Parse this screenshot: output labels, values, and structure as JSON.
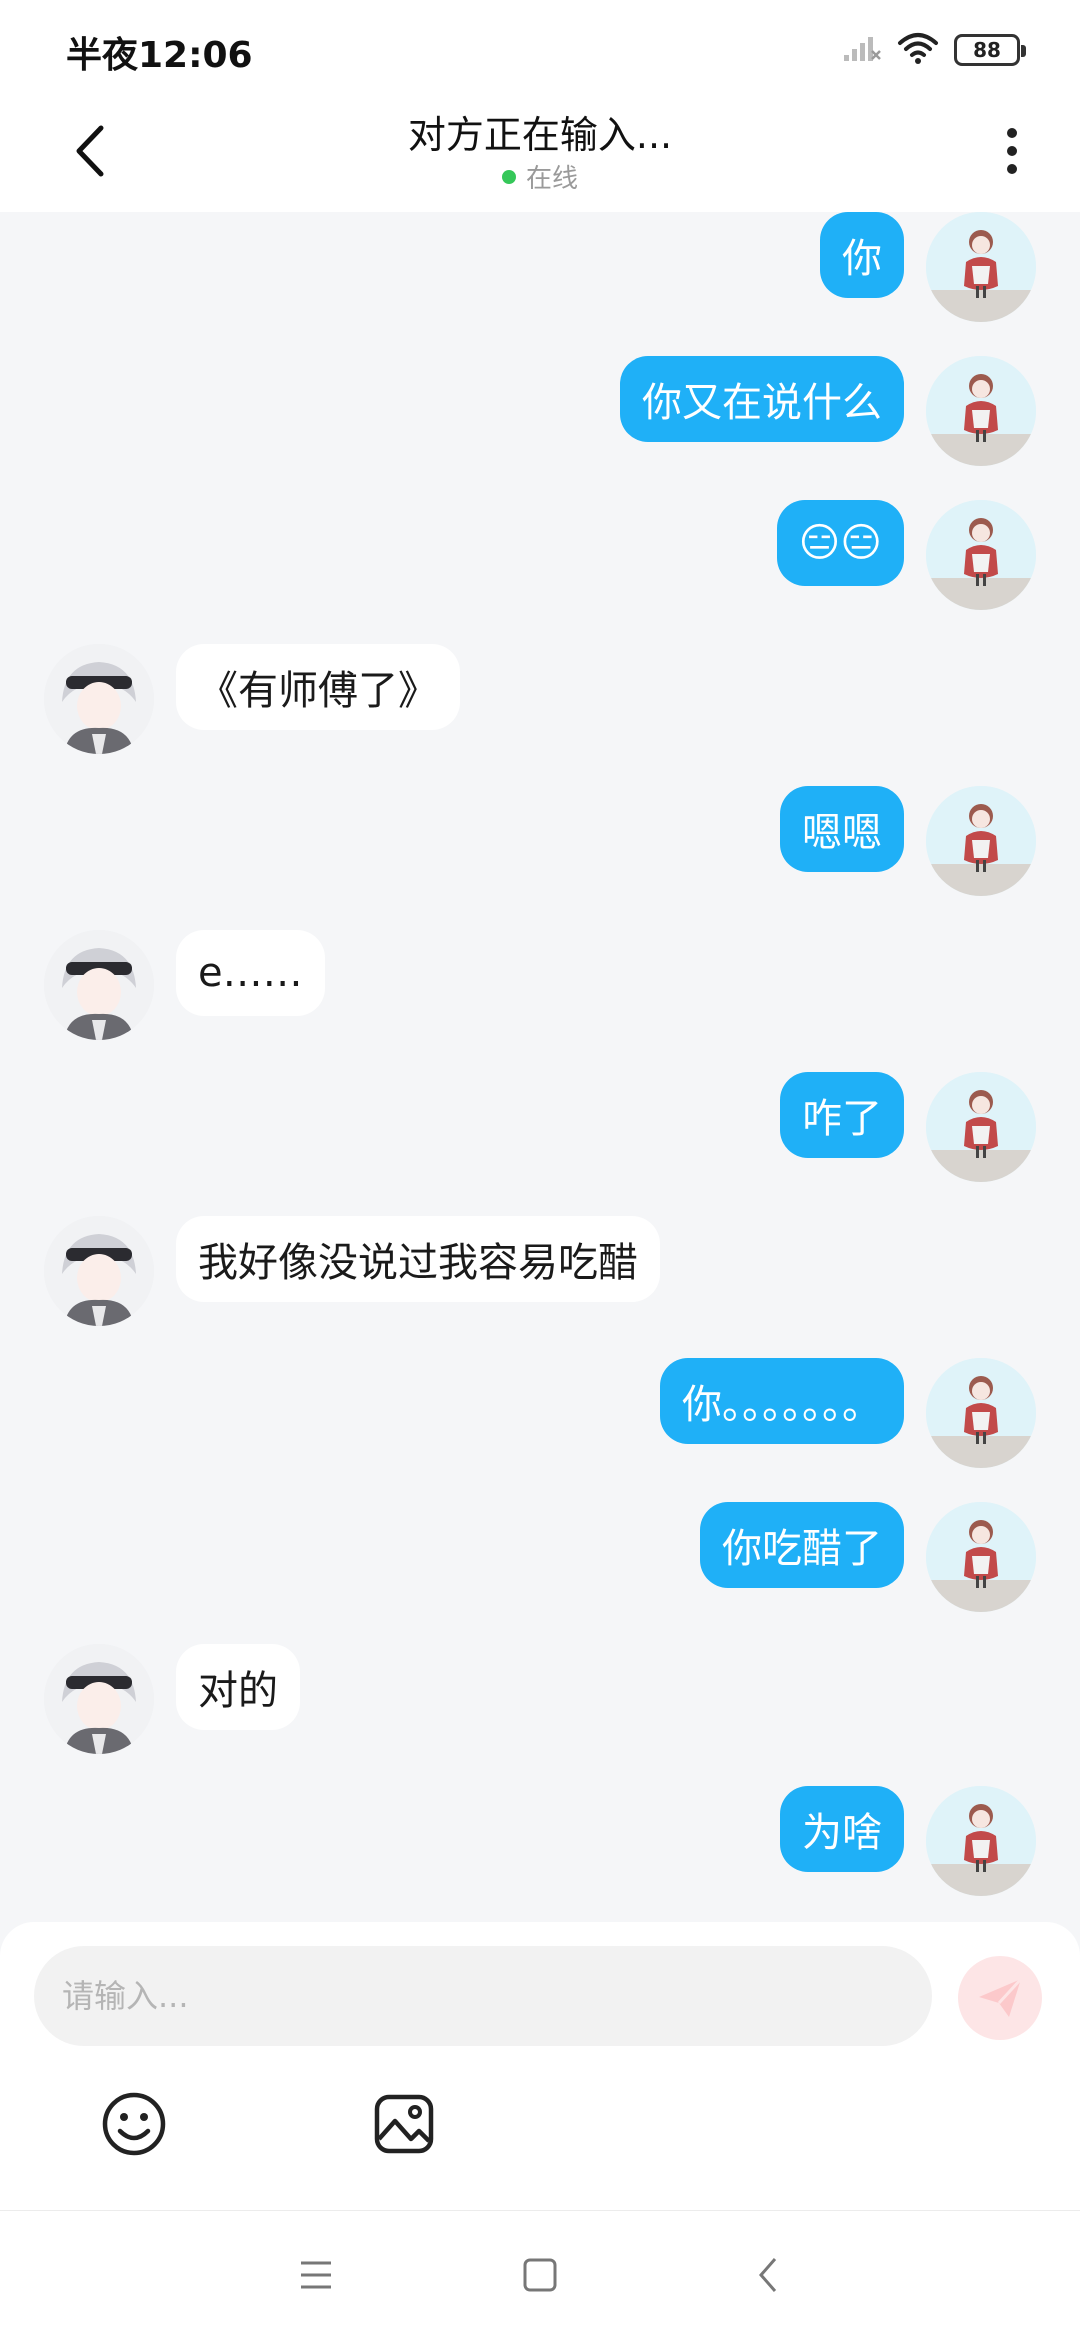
{
  "status_bar": {
    "time": "半夜12:06",
    "battery": "88",
    "icons": [
      "signal-icon",
      "wifi-icon",
      "battery-icon"
    ]
  },
  "header": {
    "title": "对方正在输入...",
    "status": "在线"
  },
  "colors": {
    "my_bubble": "#1fb0f7",
    "other_bubble": "#ffffff",
    "online": "#35c759",
    "background": "#f5f6f8"
  },
  "messages": [
    {
      "from": "me",
      "text": "你"
    },
    {
      "from": "me",
      "text": "你又在说什么"
    },
    {
      "from": "me",
      "text": "😑😑"
    },
    {
      "from": "other",
      "text": "《有师傅了》"
    },
    {
      "from": "me",
      "text": "嗯嗯"
    },
    {
      "from": "other",
      "text": "e……"
    },
    {
      "from": "me",
      "text": "咋了"
    },
    {
      "from": "other",
      "text": "我好像没说过我容易吃醋"
    },
    {
      "from": "me",
      "text": "你。。。。。。。"
    },
    {
      "from": "me",
      "text": "你吃醋了"
    },
    {
      "from": "other",
      "text": "对的"
    },
    {
      "from": "me",
      "text": "为啥"
    }
  ],
  "composer": {
    "placeholder": "请输入...",
    "value": ""
  }
}
